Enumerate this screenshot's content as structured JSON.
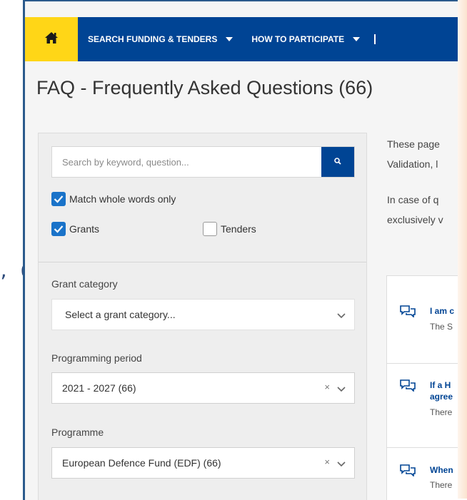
{
  "backdrop": {
    "fragment": ", 6"
  },
  "nav": {
    "home_icon": "home-icon",
    "items": [
      {
        "label": "SEARCH FUNDING & TENDERS"
      },
      {
        "label": "HOW TO PARTICIPATE"
      }
    ]
  },
  "page": {
    "title": "FAQ - Frequently Asked Questions (66)"
  },
  "filters": {
    "search": {
      "placeholder": "Search by keyword, question...",
      "value": ""
    },
    "match_whole_words": {
      "label": "Match whole words only",
      "checked": true
    },
    "grants": {
      "label": "Grants",
      "checked": true
    },
    "tenders": {
      "label": "Tenders",
      "checked": false
    },
    "grant_category": {
      "label": "Grant category",
      "value": "Select a grant category..."
    },
    "programming_period": {
      "label": "Programming period",
      "value": "2021 - 2027 (66)"
    },
    "programme": {
      "label": "Programme",
      "value": "European Defence Fund (EDF) (66)"
    },
    "clear_glyph": "×"
  },
  "intro": {
    "line1": "These page",
    "line2": "Validation, l",
    "line3": "In case of q",
    "line4": "exclusively v"
  },
  "results": [
    {
      "question": "I am c",
      "answer": "The S"
    },
    {
      "question": "If a H",
      "question2": "agree",
      "answer": "There"
    },
    {
      "question": "When",
      "answer": "There"
    }
  ],
  "colors": {
    "navbar": "#004494",
    "home": "#ffd617",
    "checkbox": "#1a73c9",
    "link": "#004494"
  }
}
